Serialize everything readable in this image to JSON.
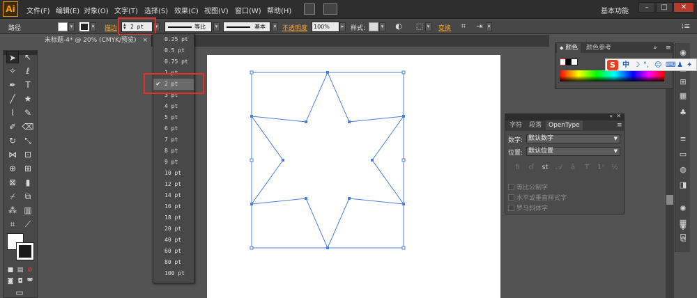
{
  "app": {
    "logo": "Ai",
    "workspace": "基本功能"
  },
  "menu": [
    "文件(F)",
    "编辑(E)",
    "对象(O)",
    "文字(T)",
    "选择(S)",
    "效果(C)",
    "视图(V)",
    "窗口(W)",
    "帮助(H)"
  ],
  "control": {
    "selection_label": "路径",
    "stroke_label": "描边",
    "stroke_value": "2 pt",
    "profile_label": "等比",
    "brush_label": "基本",
    "opacity_label": "不透明度",
    "opacity_value": "100%",
    "style_label": "样式:",
    "transform_label": "变换"
  },
  "document": {
    "tab_title": "未标题-4* @ 20% (CMYK/预览)",
    "close": "×"
  },
  "stroke_dropdown": {
    "options": [
      "0.25 pt",
      "0.5 pt",
      "0.75 pt",
      "1 pt",
      "2 pt",
      "3 pt",
      "4 pt",
      "5 pt",
      "6 pt",
      "7 pt",
      "8 pt",
      "9 pt",
      "10 pt",
      "12 pt",
      "14 pt",
      "16 pt",
      "18 pt",
      "20 pt",
      "40 pt",
      "60 pt",
      "80 pt",
      "100 pt"
    ],
    "selected": "2 pt",
    "check": "✔"
  },
  "color_panel": {
    "tabs": [
      "颜色",
      "颜色参考"
    ]
  },
  "ime": {
    "logo": "S",
    "mode": "中"
  },
  "opentype_panel": {
    "tabs": [
      "字符",
      "段落",
      "OpenType"
    ],
    "figure_label": "数字:",
    "figure_value": "默认数字",
    "position_label": "位置:",
    "position_value": "默认位置",
    "options": [
      "等比公制字",
      "水平或垂直样式字",
      "罗马斜体字"
    ]
  },
  "colors": {
    "accent": "#ff9a00",
    "highlight": "#e8302a",
    "path": "#4a7fe0"
  }
}
